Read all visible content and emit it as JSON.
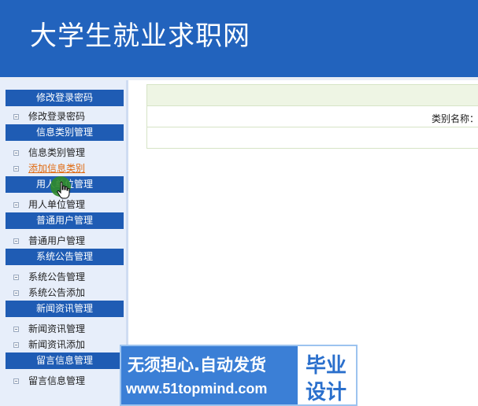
{
  "site": {
    "title": "大学生就业求职网"
  },
  "sidebar": {
    "sections": [
      {
        "title": "修改登录密码",
        "items": [
          "修改登录密码"
        ]
      },
      {
        "title": "信息类别管理",
        "items": [
          "信息类别管理",
          "添加信息类别"
        ]
      },
      {
        "title": "用人单位管理",
        "items": [
          "用人单位管理"
        ]
      },
      {
        "title": "普通用户管理",
        "items": [
          "普通用户管理"
        ]
      },
      {
        "title": "系统公告管理",
        "items": [
          "系统公告管理",
          "系统公告添加"
        ]
      },
      {
        "title": "新闻资讯管理",
        "items": [
          "新闻资讯管理",
          "新闻资讯添加"
        ]
      },
      {
        "title": "留言信息管理",
        "items": [
          "留言信息管理"
        ]
      }
    ],
    "active_item": "添加信息类别"
  },
  "form": {
    "category_label": "类别名称："
  },
  "watermark": {
    "line1": "无须担心.自动发货",
    "line2": "www.51topmind.com",
    "tag1": "毕业",
    "tag2": "设计"
  },
  "icons": {
    "cursor": "hand-pointer-icon",
    "bullet": "collapse-box-icon"
  }
}
